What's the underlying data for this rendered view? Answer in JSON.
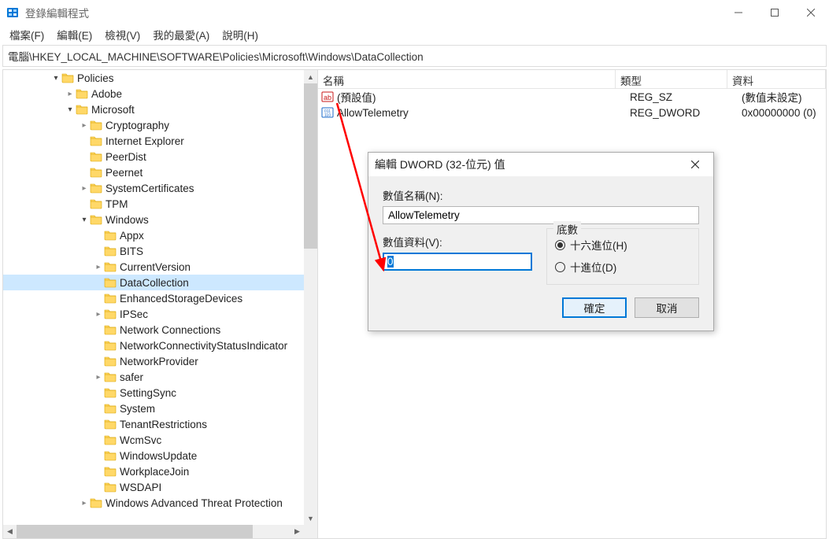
{
  "window": {
    "title": "登錄編輯程式",
    "minimize": "–",
    "maximize": "□",
    "close": "×"
  },
  "menu": {
    "file": "檔案(F)",
    "edit": "編輯(E)",
    "view": "檢視(V)",
    "favorites": "我的最愛(A)",
    "help": "說明(H)"
  },
  "address": "電腦\\HKEY_LOCAL_MACHINE\\SOFTWARE\\Policies\\Microsoft\\Windows\\DataCollection",
  "tree": {
    "items": [
      {
        "indent": 60,
        "expander": "open",
        "label": "Policies"
      },
      {
        "indent": 78,
        "expander": "closed",
        "label": "Adobe"
      },
      {
        "indent": 78,
        "expander": "open",
        "label": "Microsoft"
      },
      {
        "indent": 96,
        "expander": "closed",
        "label": "Cryptography"
      },
      {
        "indent": 96,
        "expander": "none",
        "label": "Internet Explorer"
      },
      {
        "indent": 96,
        "expander": "none",
        "label": "PeerDist"
      },
      {
        "indent": 96,
        "expander": "none",
        "label": "Peernet"
      },
      {
        "indent": 96,
        "expander": "closed",
        "label": "SystemCertificates"
      },
      {
        "indent": 96,
        "expander": "none",
        "label": "TPM"
      },
      {
        "indent": 96,
        "expander": "open",
        "label": "Windows"
      },
      {
        "indent": 114,
        "expander": "none",
        "label": "Appx"
      },
      {
        "indent": 114,
        "expander": "none",
        "label": "BITS"
      },
      {
        "indent": 114,
        "expander": "closed",
        "label": "CurrentVersion"
      },
      {
        "indent": 114,
        "expander": "none",
        "label": "DataCollection",
        "selected": true
      },
      {
        "indent": 114,
        "expander": "none",
        "label": "EnhancedStorageDevices"
      },
      {
        "indent": 114,
        "expander": "closed",
        "label": "IPSec"
      },
      {
        "indent": 114,
        "expander": "none",
        "label": "Network Connections"
      },
      {
        "indent": 114,
        "expander": "none",
        "label": "NetworkConnectivityStatusIndicator"
      },
      {
        "indent": 114,
        "expander": "none",
        "label": "NetworkProvider"
      },
      {
        "indent": 114,
        "expander": "closed",
        "label": "safer"
      },
      {
        "indent": 114,
        "expander": "none",
        "label": "SettingSync"
      },
      {
        "indent": 114,
        "expander": "none",
        "label": "System"
      },
      {
        "indent": 114,
        "expander": "none",
        "label": "TenantRestrictions"
      },
      {
        "indent": 114,
        "expander": "none",
        "label": "WcmSvc"
      },
      {
        "indent": 114,
        "expander": "none",
        "label": "WindowsUpdate"
      },
      {
        "indent": 114,
        "expander": "none",
        "label": "WorkplaceJoin"
      },
      {
        "indent": 114,
        "expander": "none",
        "label": "WSDAPI"
      },
      {
        "indent": 96,
        "expander": "closed",
        "label": "Windows Advanced Threat Protection"
      }
    ]
  },
  "list": {
    "cols": {
      "name": "名稱",
      "type": "類型",
      "data": "資料"
    },
    "rows": [
      {
        "icon": "string",
        "name": "(預設值)",
        "type": "REG_SZ",
        "data": "(數值未設定)"
      },
      {
        "icon": "dword",
        "name": "AllowTelemetry",
        "type": "REG_DWORD",
        "data": "0x00000000 (0)"
      }
    ]
  },
  "dialog": {
    "title": "編輯 DWORD (32-位元) 值",
    "name_label": "數值名稱(N):",
    "name_value": "AllowTelemetry",
    "data_label": "數值資料(V):",
    "data_value": "0",
    "base_label": "底數",
    "radio_hex": "十六進位(H)",
    "radio_dec": "十進位(D)",
    "ok": "確定",
    "cancel": "取消"
  }
}
